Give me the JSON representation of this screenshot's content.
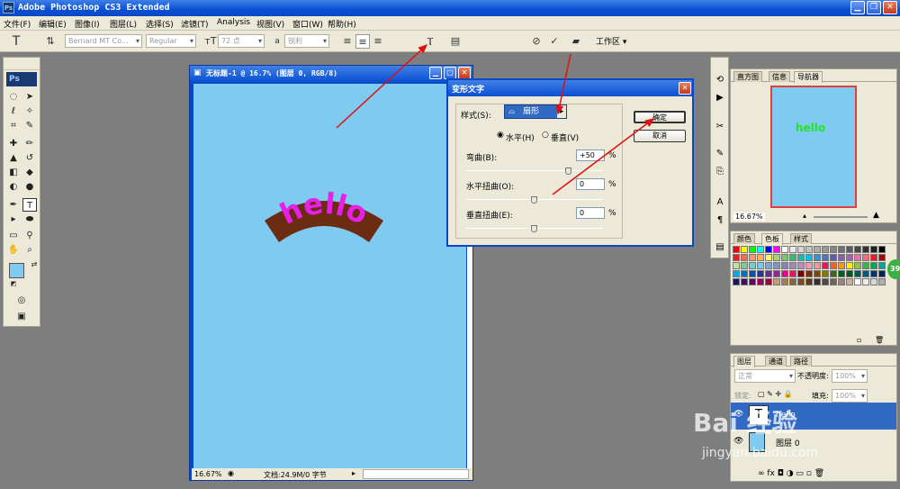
{
  "app": {
    "title": "Adobe Photoshop CS3 Extended",
    "logo": "Ps"
  },
  "menu": [
    "文件(F)",
    "编辑(E)",
    "图像(I)",
    "图层(L)",
    "选择(S)",
    "滤镜(T)",
    "Analysis",
    "视图(V)",
    "窗口(W)",
    "帮助(H)"
  ],
  "options": {
    "font_family": "Bernard MT Co...",
    "font_style": "Regular",
    "font_size": "72 点",
    "aa_label": "a",
    "aa_mode": "锐利",
    "text_color": "#22e51e",
    "workspace": "工作区"
  },
  "document": {
    "title": "无标题-1 @ 16.7% (图层 0, RGB/8)",
    "zoom": "16.67%",
    "doc_info": "文档:24.9M/0 字节",
    "canvas_color": "#7fcaf0",
    "text": "hello",
    "text_color": "#e81fe8",
    "arc_color": "#6b2c12"
  },
  "warp_dialog": {
    "title": "变形文字",
    "style_label": "样式(S):",
    "style_value": "扇形",
    "horizontal": "水平(H)",
    "vertical": "垂直(V)",
    "ok": "确定",
    "cancel": "取消",
    "bend_label": "弯曲(B):",
    "bend_value": "+50",
    "hdist_label": "水平扭曲(O):",
    "hdist_value": "0",
    "vdist_label": "垂直扭曲(E):",
    "vdist_value": "0",
    "pct": "%",
    "bend_level": 0.75,
    "hdist_level": 0.5,
    "vdist_level": 0.5
  },
  "navigator": {
    "tabs": [
      "直方图",
      "信息",
      "导航器"
    ],
    "zoom": "16.67%",
    "preview_text": "hello"
  },
  "color_panel": {
    "tabs": [
      "颜色",
      "色板",
      "样式"
    ]
  },
  "layers_panel": {
    "tabs": [
      "图层",
      "通道",
      "路径"
    ],
    "blend_mode": "正常",
    "opacity_label": "不透明度:",
    "opacity": "100%",
    "lock_label": "锁定:",
    "fill_label": "填充:",
    "fill": "100%",
    "layers": [
      {
        "name": "hello",
        "type": "text"
      },
      {
        "name": "图层 0",
        "type": "image"
      }
    ]
  },
  "side_badge": "39",
  "watermark": {
    "text": "Bai 经验",
    "url": "jingyan.baidu.com"
  },
  "swatch_colors": [
    "#ff0000",
    "#ffff00",
    "#00ff00",
    "#00ffff",
    "#0000ff",
    "#ff00ff",
    "#ffffff",
    "#ebebeb",
    "#d6d6d6",
    "#c2c2c2",
    "#adadad",
    "#999999",
    "#858585",
    "#707070",
    "#5c5c5c",
    "#474747",
    "#333333",
    "#1f1f1f",
    "#000000",
    "#ee1d24",
    "#f26c4f",
    "#f69679",
    "#fbaf5d",
    "#fff467",
    "#acd372",
    "#7cc576",
    "#3bb878",
    "#1abbb4",
    "#00bff3",
    "#438ccb",
    "#5574b9",
    "#605ca8",
    "#855fa8",
    "#a763a8",
    "#f06ea9",
    "#f26d7d",
    "#ed1c24",
    "#9e0b0f",
    "#c4df9b",
    "#82ca9c",
    "#7accc8",
    "#6dcff6",
    "#7da7d8",
    "#8393ca",
    "#8781bd",
    "#a186be",
    "#bd8cbf",
    "#f49ac1",
    "#f5989d",
    "#ed145b",
    "#f26522",
    "#f7941d",
    "#fff200",
    "#8dc63f",
    "#39b54a",
    "#00a651",
    "#00a99d",
    "#00aeef",
    "#0072bc",
    "#0054a6",
    "#2e3192",
    "#662d91",
    "#92278f",
    "#ec008c",
    "#ed145b",
    "#790000",
    "#7b2e00",
    "#7d4900",
    "#827b00",
    "#406618",
    "#005e20",
    "#005826",
    "#005952",
    "#005b7f",
    "#003471",
    "#002157",
    "#1b1464",
    "#440e62",
    "#630460",
    "#9e005d",
    "#9e0039",
    "#c69c6e",
    "#a67c52",
    "#8c6239",
    "#754c24",
    "#603913",
    "#362f2d",
    "#534741",
    "#736357",
    "#998675",
    "#c7b299",
    "#ffffff",
    "#ebebeb",
    "#d6d6d6",
    "#adadad"
  ]
}
